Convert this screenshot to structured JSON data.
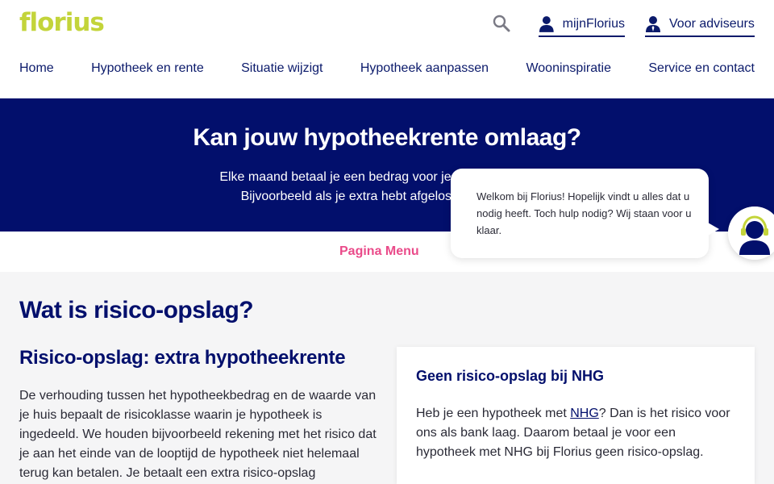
{
  "brand": {
    "logo_text": "florius",
    "logo_color": "#c3d43a",
    "navy": "#020f6c",
    "pink": "#ea4b8a"
  },
  "header": {
    "search_icon": "search-icon",
    "mijn_label": "mijnFlorius",
    "adviseurs_label": "Voor adviseurs"
  },
  "nav": {
    "items": [
      "Home",
      "Hypotheek en rente",
      "Situatie wijzigt",
      "Hypotheek aanpassen",
      "Wooninspiratie",
      "Service en contact"
    ]
  },
  "hero": {
    "title": "Kan jouw hypotheekrente omlaag?",
    "line1": "Elke maand betaal je een bedrag voor je hypotheek. Soms",
    "line2": "Bijvoorbeeld als je extra hebt afgelost of als je woni"
  },
  "page_menu": {
    "label": "Pagina Menu"
  },
  "chat": {
    "message": "Welkom bij Florius! Hopelijk vindt u alles dat u nodig heeft. Toch hulp nodig? Wij staan voor u klaar.",
    "avatar_icon": "support-agent-icon"
  },
  "main": {
    "heading": "Wat is risico-opslag?",
    "subheading": "Risico-opslag: extra hypotheekrente",
    "paragraph": "De verhouding tussen het hypotheekbedrag en de waarde van je huis bepaalt de risicoklasse waarin je hypotheek is ingedeeld. We houden bijvoorbeeld rekening met het risico dat je aan het einde van de looptijd de hypotheek niet helemaal terug kan betalen. Je betaalt een extra risico-opslag"
  },
  "card": {
    "title": "Geen risico-opslag bij NHG",
    "text_before": "Heb je een hypotheek met ",
    "link": "NHG",
    "text_after": "? Dan is het risico voor ons als bank laag. Daarom betaal je voor een hypotheek met NHG bij Florius geen risico-opslag."
  }
}
